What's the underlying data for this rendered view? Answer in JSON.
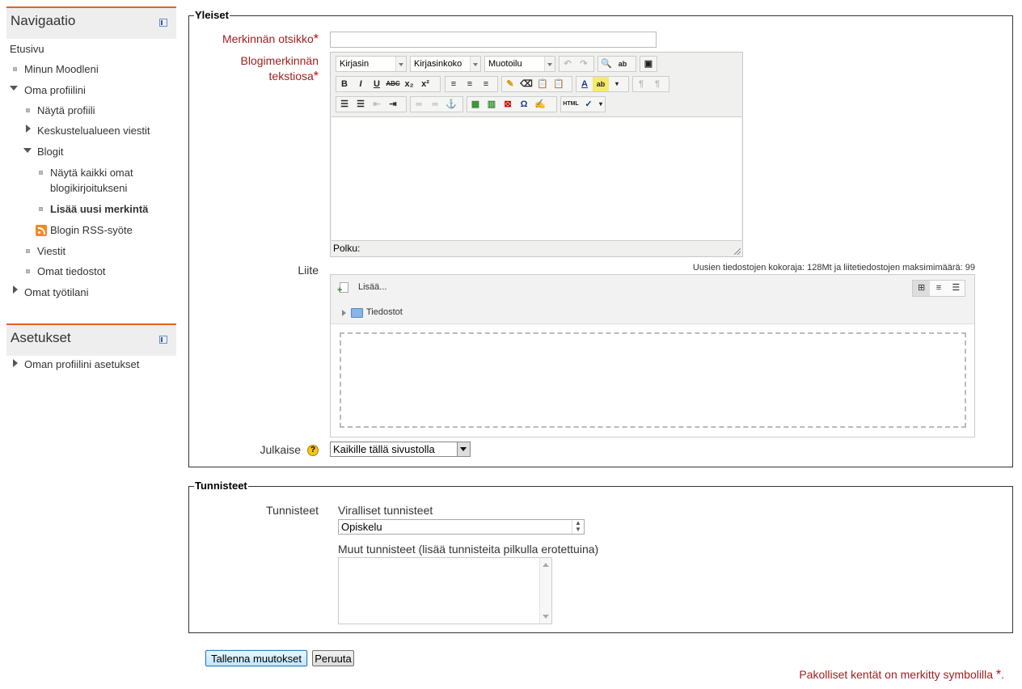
{
  "navigation": {
    "title": "Navigaatio",
    "items": [
      {
        "label": "Etusivu"
      },
      {
        "label": "Minun Moodleni"
      },
      {
        "label": "Oma profiilini"
      },
      {
        "label": "Näytä profiili"
      },
      {
        "label": "Keskustelualueen viestit"
      },
      {
        "label": "Blogit"
      },
      {
        "label": "Näytä kaikki omat",
        "label2": "blogikirjoitukseni"
      },
      {
        "label": "Lisää uusi merkintä"
      },
      {
        "label": "Blogin RSS-syöte"
      },
      {
        "label": "Viestit"
      },
      {
        "label": "Omat tiedostot"
      },
      {
        "label": "Omat työtilani"
      }
    ]
  },
  "settings": {
    "title": "Asetukset",
    "items": [
      {
        "label": "Oman profiilini asetukset"
      }
    ]
  },
  "general": {
    "legend": "Yleiset",
    "title_label": "Merkinnän otsikko",
    "title_value": "",
    "body_label_line1": "Blogimerkinnän",
    "body_label_line2": "tekstiosa",
    "required_mark": "*",
    "editor": {
      "font_select": "Kirjasin",
      "size_select": "Kirjasinkoko",
      "format_select": "Muotoilu",
      "path_label": "Polku:",
      "buttons": {
        "bold": "B",
        "italic": "I",
        "underline": "U",
        "strike": "ABC",
        "sub": "x₂",
        "sup": "x²",
        "omega": "Ω",
        "html": "HTML",
        "color": "A",
        "backcolor": "ab"
      }
    },
    "attachment_label": "Liite",
    "attachment_info": "Uusien tiedostojen kokoraja: 128Mt ja liitetiedostojen maksimimäärä: 99",
    "add_label": "Lisää...",
    "folder_label": "Tiedostot",
    "publish_label": "Julkaise",
    "publish_value": "Kaikille tällä sivustolla",
    "help_glyph": "?"
  },
  "tags": {
    "legend": "Tunnisteet",
    "label": "Tunnisteet",
    "official_label": "Viralliset tunnisteet",
    "official_value": "Opiskelu",
    "other_label": "Muut tunnisteet (lisää tunnisteita pilkulla erotettuina)",
    "other_value": ""
  },
  "actions": {
    "save": "Tallenna muutokset",
    "cancel": "Peruuta"
  },
  "footer_note": "Pakolliset kentät on merkitty symbolilla",
  "colors": {
    "accent": "#e0632a",
    "required": "#a11f1f",
    "link": "#333333"
  }
}
